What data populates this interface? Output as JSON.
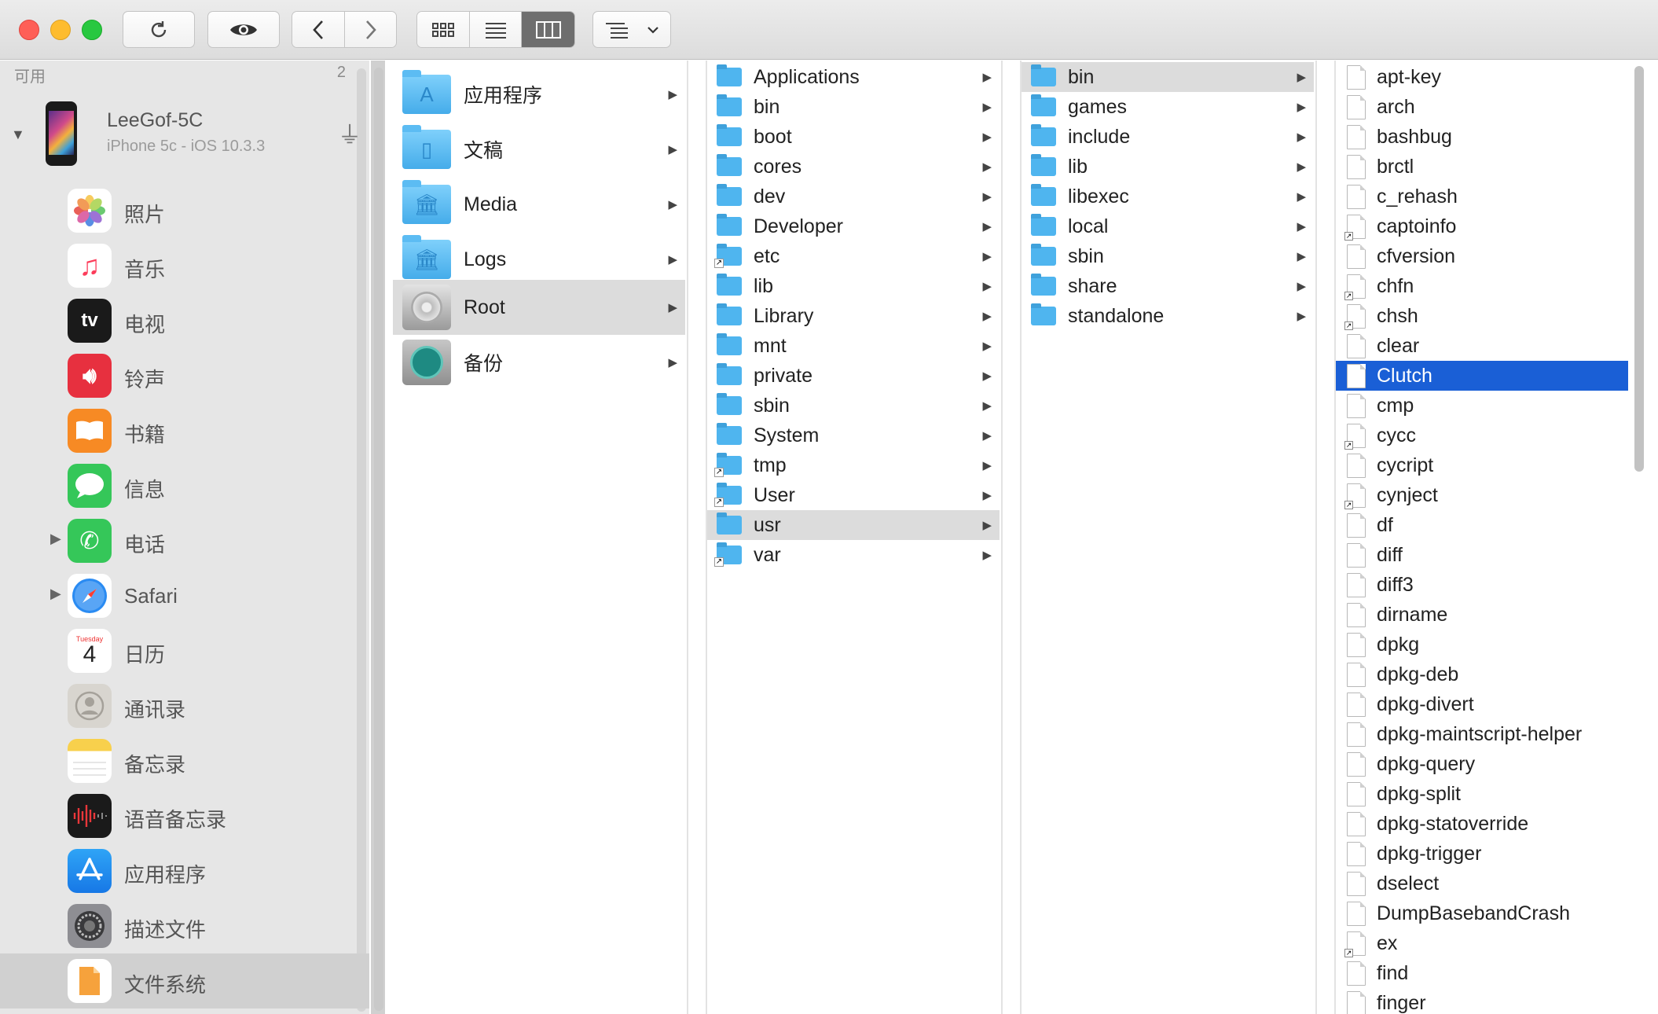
{
  "toolbar": {
    "buttons": [
      "refresh-icon",
      "eye-icon",
      "back-icon",
      "forward-icon",
      "icon-view-icon",
      "list-view-icon",
      "column-view-icon",
      "arrange-icon",
      "chevron-down-icon"
    ]
  },
  "sidebar": {
    "section_title": "可用",
    "section_count": "2",
    "device": {
      "name": "LeeGof-5C",
      "subtitle": "iPhone 5c - iOS 10.3.3"
    },
    "calendar": {
      "weekday": "Tuesday",
      "day": "4"
    },
    "items": [
      {
        "label": "照片",
        "icon": "photos-icon"
      },
      {
        "label": "音乐",
        "icon": "music-icon"
      },
      {
        "label": "电视",
        "icon": "tv-icon",
        "glyph": "tv"
      },
      {
        "label": "铃声",
        "icon": "ringtones-icon"
      },
      {
        "label": "书籍",
        "icon": "books-icon"
      },
      {
        "label": "信息",
        "icon": "messages-icon"
      },
      {
        "label": "电话",
        "icon": "phone-icon"
      },
      {
        "label": "Safari",
        "icon": "safari-icon"
      },
      {
        "label": "日历",
        "icon": "calendar-icon"
      },
      {
        "label": "通讯录",
        "icon": "contacts-icon"
      },
      {
        "label": "备忘录",
        "icon": "notes-icon"
      },
      {
        "label": "语音备忘录",
        "icon": "voice-memos-icon"
      },
      {
        "label": "应用程序",
        "icon": "app-store-icon"
      },
      {
        "label": "描述文件",
        "icon": "profiles-icon"
      },
      {
        "label": "文件系统",
        "icon": "file-system-icon"
      }
    ]
  },
  "columns": {
    "col1": [
      "应用程序",
      "文稿",
      "Media",
      "Logs",
      "Root",
      "备份"
    ],
    "col2": [
      "Applications",
      "bin",
      "boot",
      "cores",
      "dev",
      "Developer",
      "etc",
      "lib",
      "Library",
      "mnt",
      "private",
      "sbin",
      "System",
      "tmp",
      "User",
      "usr",
      "var"
    ],
    "col3": [
      "bin",
      "games",
      "include",
      "lib",
      "libexec",
      "local",
      "sbin",
      "share",
      "standalone"
    ],
    "col4": [
      "apt-key",
      "arch",
      "bashbug",
      "brctl",
      "c_rehash",
      "captoinfo",
      "cfversion",
      "chfn",
      "chsh",
      "clear",
      "Clutch",
      "cmp",
      "cycc",
      "cycript",
      "cynject",
      "df",
      "diff",
      "diff3",
      "dirname",
      "dpkg",
      "dpkg-deb",
      "dpkg-divert",
      "dpkg-maintscript-helper",
      "dpkg-query",
      "dpkg-split",
      "dpkg-statoverride",
      "dpkg-trigger",
      "dselect",
      "DumpBasebandCrash",
      "ex",
      "find",
      "finger"
    ]
  },
  "selection": {
    "col1": "Root",
    "col2": "usr",
    "col3": "bin",
    "col4": "Clutch"
  },
  "colors": {
    "selection_blue": "#1a5fd6",
    "folder_blue": "#4fb5ef"
  }
}
